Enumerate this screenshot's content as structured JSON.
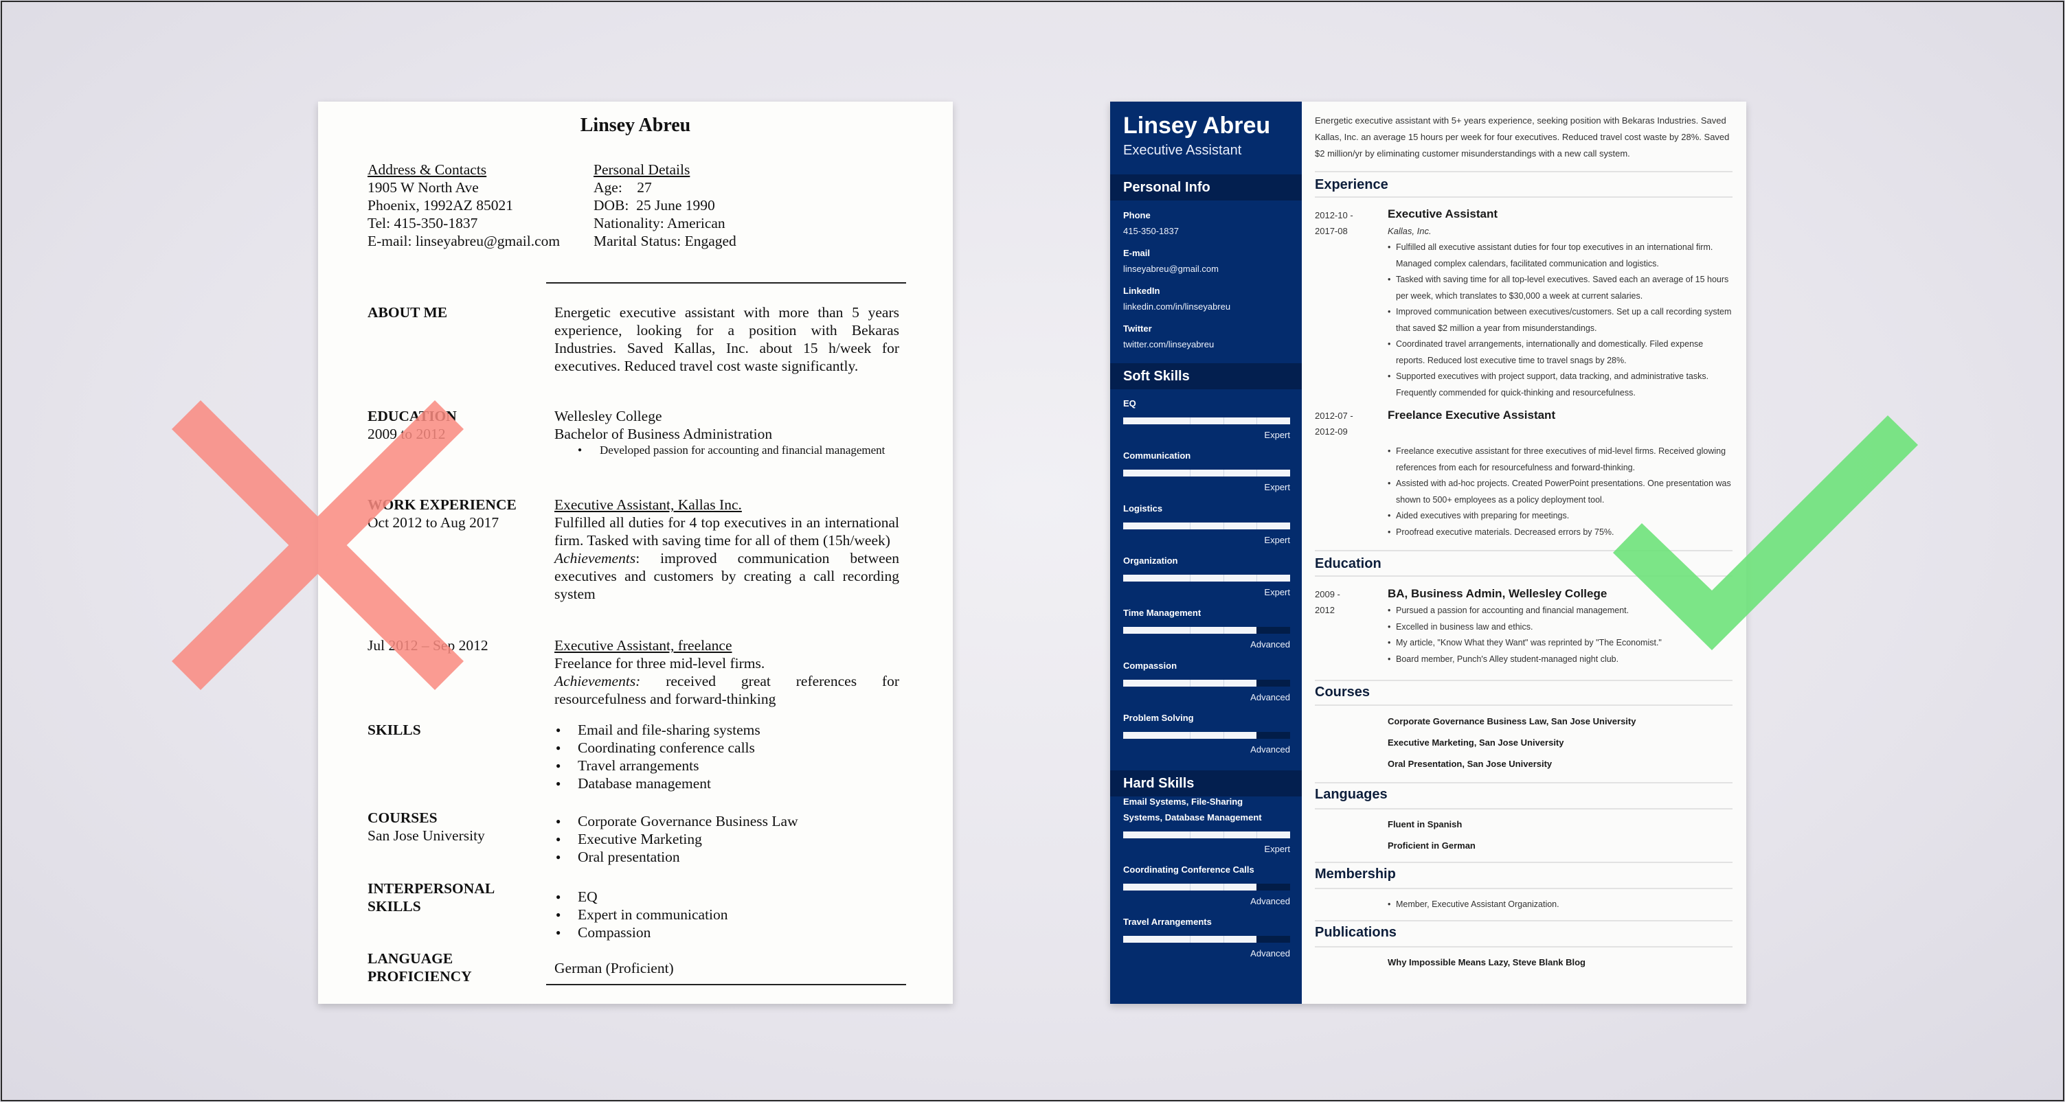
{
  "bad_resume": {
    "name": "Linsey Abreu",
    "contacts": {
      "heading": "Address & Contacts",
      "lines": [
        "1905 W North Ave",
        "Phoenix, 1992AZ 85021",
        "Tel: 415-350-1837",
        "E-mail: linseyabreu@gmail.com"
      ]
    },
    "personal": {
      "heading": "Personal Details",
      "lines": [
        "Age:    27",
        "DOB:  25 June 1990",
        "Nationality: American",
        "Marital Status: Engaged"
      ]
    },
    "about": {
      "label": "ABOUT ME",
      "text": "Energetic executive assistant with more than 5 years experience, looking for a position with Bekaras Industries. Saved Kallas, Inc. about 15 h/week for executives. Reduced travel cost waste significantly."
    },
    "education": {
      "label": "EDUCATION",
      "dates": "2009 to 2012",
      "school": "Wellesley College",
      "degree": "Bachelor of Business Administration",
      "bullets": [
        "Developed passion for accounting and financial management"
      ]
    },
    "work": {
      "label": "WORK EXPERIENCE",
      "jobs": [
        {
          "dates": "Oct 2012 to Aug 2017",
          "title": "Executive Assistant, Kallas Inc.",
          "description": "Fulfilled all duties for 4 top executives in an international firm. Tasked with saving time for all of them (15h/week)",
          "achievements_label": "Achievements",
          "achievements": ": improved communication between executives and customers by creating a call recording system"
        },
        {
          "dates": "Jul 2012 – Sep 2012",
          "title": "Executive Assistant, freelance",
          "description": "Freelance for three mid-level firms.",
          "achievements_label": "Achievements:",
          "achievements": " received great references for resourcefulness and forward-thinking"
        }
      ]
    },
    "skills": {
      "label": "SKILLS",
      "items": [
        "Email and file-sharing systems",
        "Coordinating conference calls",
        "Travel arrangements",
        "Database management"
      ]
    },
    "courses": {
      "label": "COURSES",
      "sub": "San Jose University",
      "items": [
        "Corporate Governance Business Law",
        "Executive Marketing",
        "Oral presentation"
      ]
    },
    "interpersonal": {
      "label_line1": "INTERPERSONAL",
      "label_line2": "SKILLS",
      "items": [
        "EQ",
        "Expert in communication",
        "Compassion"
      ]
    },
    "language": {
      "label_line1": "LANGUAGE",
      "label_line2": "PROFICIENCY",
      "value": "German (Proficient)"
    }
  },
  "good_resume": {
    "sidebar": {
      "name": "Linsey Abreu",
      "title": "Executive Assistant",
      "personal_info": {
        "heading": "Personal Info",
        "fields": [
          {
            "label": "Phone",
            "value": "415-350-1837"
          },
          {
            "label": "E-mail",
            "value": "linseyabreu@gmail.com"
          },
          {
            "label": "LinkedIn",
            "value": "linkedin.com/in/linseyabreu"
          },
          {
            "label": "Twitter",
            "value": "twitter.com/linseyabreu"
          }
        ]
      },
      "soft_skills": {
        "heading": "Soft Skills",
        "items": [
          {
            "name": "EQ",
            "level": "Expert",
            "fill": 1.0
          },
          {
            "name": "Communication",
            "level": "Expert",
            "fill": 1.0
          },
          {
            "name": "Logistics",
            "level": "Expert",
            "fill": 1.0
          },
          {
            "name": "Organization",
            "level": "Expert",
            "fill": 1.0
          },
          {
            "name": "Time Management",
            "level": "Advanced",
            "fill": 0.8
          },
          {
            "name": "Compassion",
            "level": "Advanced",
            "fill": 0.8
          },
          {
            "name": "Problem Solving",
            "level": "Advanced",
            "fill": 0.8
          }
        ]
      },
      "hard_skills": {
        "heading": "Hard Skills",
        "items": [
          {
            "name_line1": "Email Systems, File-Sharing",
            "name_line2": "Systems, Database Management",
            "level": "Expert",
            "fill": 1.0
          },
          {
            "name_line1": "Coordinating Conference Calls",
            "name_line2": "",
            "level": "Advanced",
            "fill": 0.8
          },
          {
            "name_line1": "Travel Arrangements",
            "name_line2": "",
            "level": "Advanced",
            "fill": 0.8
          }
        ]
      }
    },
    "summary": "Energetic executive assistant with 5+ years experience, seeking position with Bekaras Industries. Saved Kallas, Inc. an average 15 hours per week for four executives. Reduced travel cost waste by 28%. Saved $2 million/yr by eliminating customer misunderstandings with a new call system.",
    "experience": {
      "heading": "Experience",
      "jobs": [
        {
          "date_start": "2012-10 -",
          "date_end": "2017-08",
          "title": "Executive Assistant",
          "company": "Kallas, Inc.",
          "bullets": [
            "Fulfilled all executive assistant duties for four top executives in an international firm. Managed complex calendars, facilitated communication and logistics.",
            "Tasked with saving time for all top-level executives. Saved each an average of 15 hours per week, which translates to $30,000 a week at current salaries.",
            "Improved communication between executives/customers. Set up a call recording system that saved $2 million a year from misunderstandings.",
            "Coordinated travel arrangements, internationally and domestically. Filed expense reports. Reduced lost executive time to travel snags by 28%.",
            "Supported executives with project support, data tracking, and administrative tasks. Frequently commended for quick-thinking and resourcefulness."
          ]
        },
        {
          "date_start": "2012-07 -",
          "date_end": "2012-09",
          "title": "Freelance Executive Assistant",
          "company": "",
          "bullets": [
            "Freelance executive assistant for three executives of mid-level firms. Received glowing references from each for resourcefulness and forward-thinking.",
            "Assisted with ad-hoc projects. Created PowerPoint presentations. One presentation was shown to 500+ employees as a policy deployment tool.",
            "Aided executives with preparing for meetings.",
            "Proofread executive materials. Decreased errors by 75%."
          ]
        }
      ]
    },
    "education": {
      "heading": "Education",
      "date_start": "2009 -",
      "date_end": "2012",
      "title": "BA, Business Admin, Wellesley College",
      "bullets": [
        "Pursued a passion for accounting and financial management.",
        "Excelled in business law and ethics.",
        "My article, \"Know What they Want\" was reprinted by \"The Economist.\"",
        "Board member, Punch's Alley student-managed night club."
      ]
    },
    "courses": {
      "heading": "Courses",
      "items": [
        "Corporate Governance Business Law, San Jose University",
        "Executive Marketing, San Jose University",
        "Oral Presentation, San Jose University"
      ]
    },
    "languages": {
      "heading": "Languages",
      "items": [
        "Fluent in Spanish",
        "Proficient in German"
      ]
    },
    "membership": {
      "heading": "Membership",
      "items": [
        "Member, Executive Assistant Organization."
      ]
    },
    "publications": {
      "heading": "Publications",
      "items": [
        "Why Impossible Means Lazy, Steve Blank Blog"
      ]
    }
  },
  "marks": {
    "bad": {
      "icon": "x-mark-icon",
      "color": "#fa8a80"
    },
    "good": {
      "icon": "checkmark-icon",
      "color": "#6ee27a"
    }
  },
  "colors": {
    "sidebar_bg": "#042c6d",
    "sidebar_header_bg": "#031f4f",
    "section_title": "#0d1e3b"
  }
}
